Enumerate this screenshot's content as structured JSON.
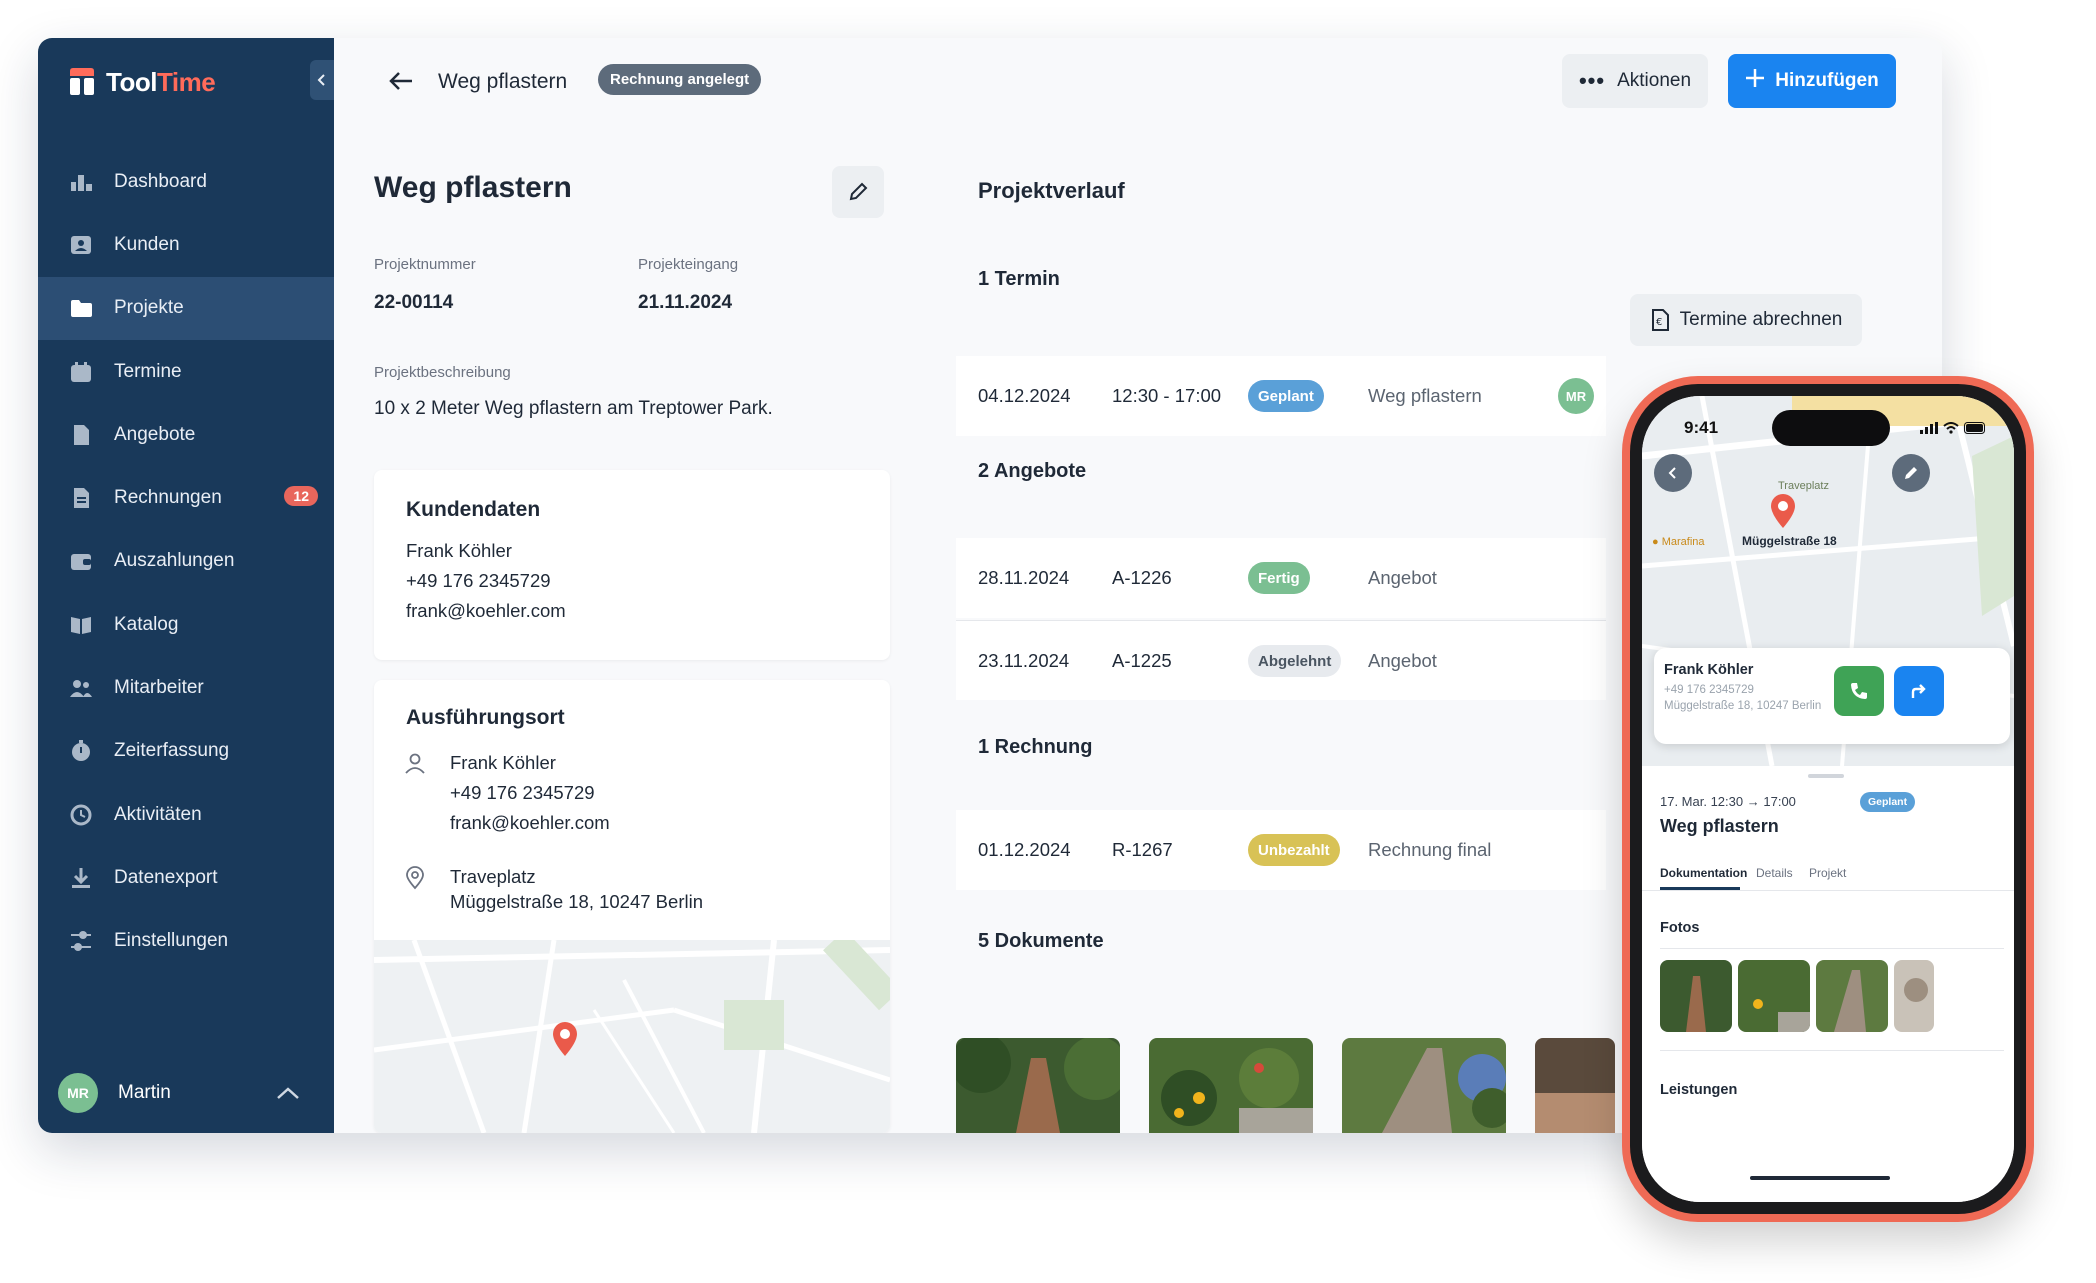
{
  "app": {
    "logo": {
      "part1": "Tool",
      "part2": "Time"
    },
    "sidebar": {
      "items": [
        {
          "label": "Dashboard",
          "icon": "dashboard-icon"
        },
        {
          "label": "Kunden",
          "icon": "customers-icon"
        },
        {
          "label": "Projekte",
          "icon": "folder-icon",
          "active": true
        },
        {
          "label": "Termine",
          "icon": "calendar-icon"
        },
        {
          "label": "Angebote",
          "icon": "document-icon"
        },
        {
          "label": "Rechnungen",
          "icon": "invoice-icon",
          "badge": "12"
        },
        {
          "label": "Auszahlungen",
          "icon": "wallet-icon"
        },
        {
          "label": "Katalog",
          "icon": "book-icon"
        },
        {
          "label": "Mitarbeiter",
          "icon": "team-icon"
        },
        {
          "label": "Zeiterfassung",
          "icon": "timer-icon"
        },
        {
          "label": "Aktivitäten",
          "icon": "history-icon"
        },
        {
          "label": "Datenexport",
          "icon": "download-icon"
        },
        {
          "label": "Einstellungen",
          "icon": "settings-icon"
        }
      ],
      "user": {
        "initials": "MR",
        "name": "Martin"
      }
    },
    "topbar": {
      "title": "Weg pflastern",
      "status": "Rechnung angelegt",
      "actions_label": "Aktionen",
      "add_label": "Hinzufügen"
    },
    "project": {
      "title": "Weg pflastern",
      "number_label": "Projektnummer",
      "number": "22-00114",
      "date_label": "Projekteingang",
      "date": "21.11.2024",
      "desc_label": "Projektbeschreibung",
      "desc": "10 x 2 Meter Weg pflastern am Treptower Park."
    },
    "customer": {
      "title": "Kundendaten",
      "name": "Frank Köhler",
      "phone": "+49 176 2345729",
      "email": "frank@koehler.com"
    },
    "location": {
      "title": "Ausführungsort",
      "name": "Frank Köhler",
      "phone": "+49 176 2345729",
      "email": "frank@koehler.com",
      "place": "Traveplatz",
      "address": "Müggelstraße 18, 10247 Berlin"
    },
    "history": {
      "title": "Projektverlauf",
      "appointments_title": "1 Termin",
      "bill_appointments_label": "Termine abrechnen",
      "appointments": [
        {
          "date": "04.12.2024",
          "time": "12:30 - 17:00",
          "status": "Geplant",
          "name": "Weg pflastern",
          "assignee": "MR"
        }
      ],
      "offers_title": "2 Angebote",
      "offers": [
        {
          "date": "28.11.2024",
          "number": "A-1226",
          "status": "Fertig",
          "name": "Angebot"
        },
        {
          "date": "23.11.2024",
          "number": "A-1225",
          "status": "Abgelehnt",
          "name": "Angebot"
        }
      ],
      "invoices_title": "1 Rechnung",
      "invoices": [
        {
          "date": "01.12.2024",
          "number": "R-1267",
          "status": "Unbezahlt",
          "name": "Rechnung final"
        }
      ],
      "documents_title": "5 Dokumente"
    }
  },
  "phone": {
    "time": "9:41",
    "map_labels": {
      "place": "Traveplatz",
      "address": "Müggelstraße 18",
      "poi": "Marafina"
    },
    "contact": {
      "name": "Frank Köhler",
      "phone": "+49 176 2345729",
      "address": "Müggelstraße 18, 10247 Berlin"
    },
    "appointment": {
      "date": "17. Mar. 12:30",
      "end": "17:00",
      "status": "Geplant",
      "title": "Weg pflastern"
    },
    "tabs": [
      "Dokumentation",
      "Details",
      "Projekt"
    ],
    "photos_title": "Fotos",
    "services_title": "Leistungen"
  },
  "colors": {
    "sidebar": "#19395a",
    "accent": "#1a84f0",
    "brand": "#ff6b5a",
    "planned": "#5aa0d8",
    "done": "#7bbf92",
    "unpaid": "#d8c256"
  }
}
